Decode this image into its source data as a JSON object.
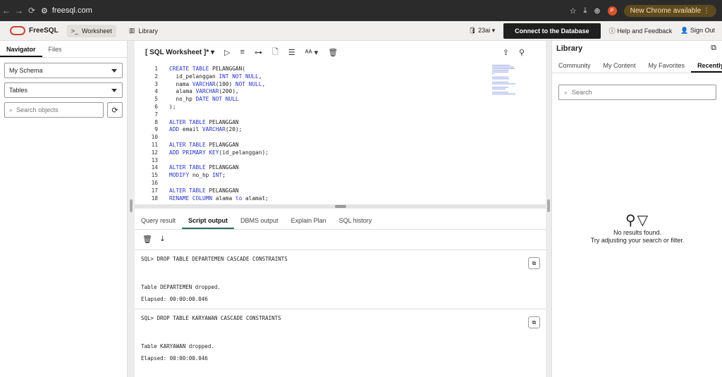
{
  "browser": {
    "url": "freesql.com",
    "new_chrome": "New Chrome available",
    "avatar": "P"
  },
  "app": {
    "logo": "FreeSQL",
    "tabs": [
      {
        "label": "Worksheet",
        "icon": ">_"
      },
      {
        "label": "Library"
      }
    ],
    "version": "23ai",
    "connect": "Connect to the Database",
    "help": "Help and Feedback",
    "signout": "Sign Out"
  },
  "navigator": {
    "tabs": [
      "Navigator",
      "Files"
    ],
    "schema": "My Schema",
    "object_type": "Tables",
    "search_placeholder": "Search objects"
  },
  "worksheet": {
    "title": "[ SQL Worksheet ]*",
    "lines": [
      {
        "n": "1",
        "code": [
          {
            "k": "CREATE TABLE",
            "c": " PELANGGAN("
          }
        ]
      },
      {
        "n": "2",
        "code": [
          {
            "c": "  id_pelanggan "
          },
          {
            "k": "INT NOT NULL"
          },
          {
            "c": ","
          }
        ]
      },
      {
        "n": "3",
        "code": [
          {
            "c": "  nama "
          },
          {
            "k": "VARCHAR"
          },
          {
            "c": "(100) "
          },
          {
            "k": "NOT NULL"
          },
          {
            "c": ","
          }
        ]
      },
      {
        "n": "4",
        "code": [
          {
            "c": "  alama "
          },
          {
            "k": "VARCHAR"
          },
          {
            "c": "(200),"
          }
        ]
      },
      {
        "n": "5",
        "code": [
          {
            "c": "  no_hp "
          },
          {
            "k": "DATE NOT NULL"
          }
        ]
      },
      {
        "n": "6",
        "code": [
          {
            "c": ");"
          }
        ]
      },
      {
        "n": "7",
        "code": []
      },
      {
        "n": "8",
        "code": [
          {
            "k": "ALTER TABLE"
          },
          {
            "c": " PELANGGAN"
          }
        ]
      },
      {
        "n": "9",
        "code": [
          {
            "k": "ADD"
          },
          {
            "c": " email "
          },
          {
            "k": "VARCHAR"
          },
          {
            "c": "(20);"
          }
        ]
      },
      {
        "n": "10",
        "code": []
      },
      {
        "n": "11",
        "code": [
          {
            "k": "ALTER TABLE"
          },
          {
            "c": " PELANGGAN"
          }
        ]
      },
      {
        "n": "12",
        "code": [
          {
            "k": "ADD PRIMARY KEY"
          },
          {
            "c": "(id_pelanggan);"
          }
        ]
      },
      {
        "n": "13",
        "code": []
      },
      {
        "n": "14",
        "code": [
          {
            "k": "ALTER TABLE"
          },
          {
            "c": " PELANGGAN"
          }
        ]
      },
      {
        "n": "15",
        "code": [
          {
            "k": "MODIFY"
          },
          {
            "c": " no_hp "
          },
          {
            "k": "INT"
          },
          {
            "c": ";"
          }
        ]
      },
      {
        "n": "16",
        "code": []
      },
      {
        "n": "17",
        "code": [
          {
            "k": "ALTER TABLE"
          },
          {
            "c": " PELANGGAN"
          }
        ]
      },
      {
        "n": "18",
        "code": [
          {
            "k": "RENAME COLUMN"
          },
          {
            "c": " alama "
          },
          {
            "k": "to"
          },
          {
            "c": " alamat;"
          }
        ]
      }
    ]
  },
  "results": {
    "tabs": [
      "Query result",
      "Script output",
      "DBMS output",
      "Explain Plan",
      "SQL history"
    ],
    "outputs": [
      {
        "cmd": "SQL> DROP TABLE DEPARTEMEN CASCADE CONSTRAINTS",
        "msg": "Table DEPARTEMEN dropped.",
        "elapsed": "Elapsed: 00:00:00.046"
      },
      {
        "cmd": "SQL> DROP TABLE KARYAWAN CASCADE CONSTRAINTS",
        "msg": "Table KARYAWAN dropped.",
        "elapsed": "Elapsed: 00:00:00.046"
      }
    ]
  },
  "library": {
    "title": "Library",
    "tabs": [
      "Community",
      "My Content",
      "My Favorites",
      "Recently V"
    ],
    "search_placeholder": "Search",
    "empty_title": "No results found.",
    "empty_sub": "Try adjusting your search or filter."
  }
}
